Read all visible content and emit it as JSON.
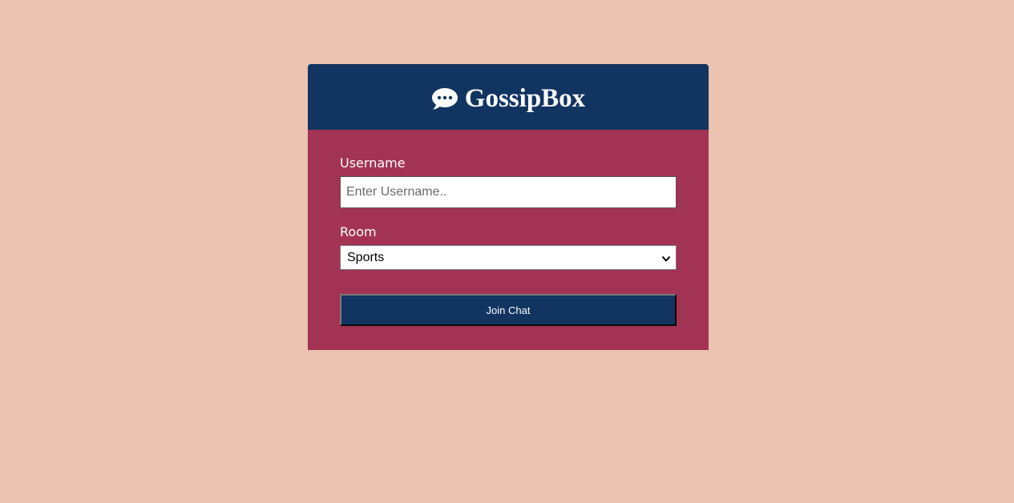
{
  "app": {
    "title": "GossipBox",
    "icon": "chat-bubble-icon"
  },
  "form": {
    "username_label": "Username",
    "username_placeholder": "Enter Username..",
    "username_value": "",
    "room_label": "Room",
    "room_selected": "Sports",
    "join_button_label": "Join Chat"
  },
  "colors": {
    "background": "#ebc1af",
    "header": "#123460",
    "form_panel": "#a33355",
    "button": "#123460"
  }
}
